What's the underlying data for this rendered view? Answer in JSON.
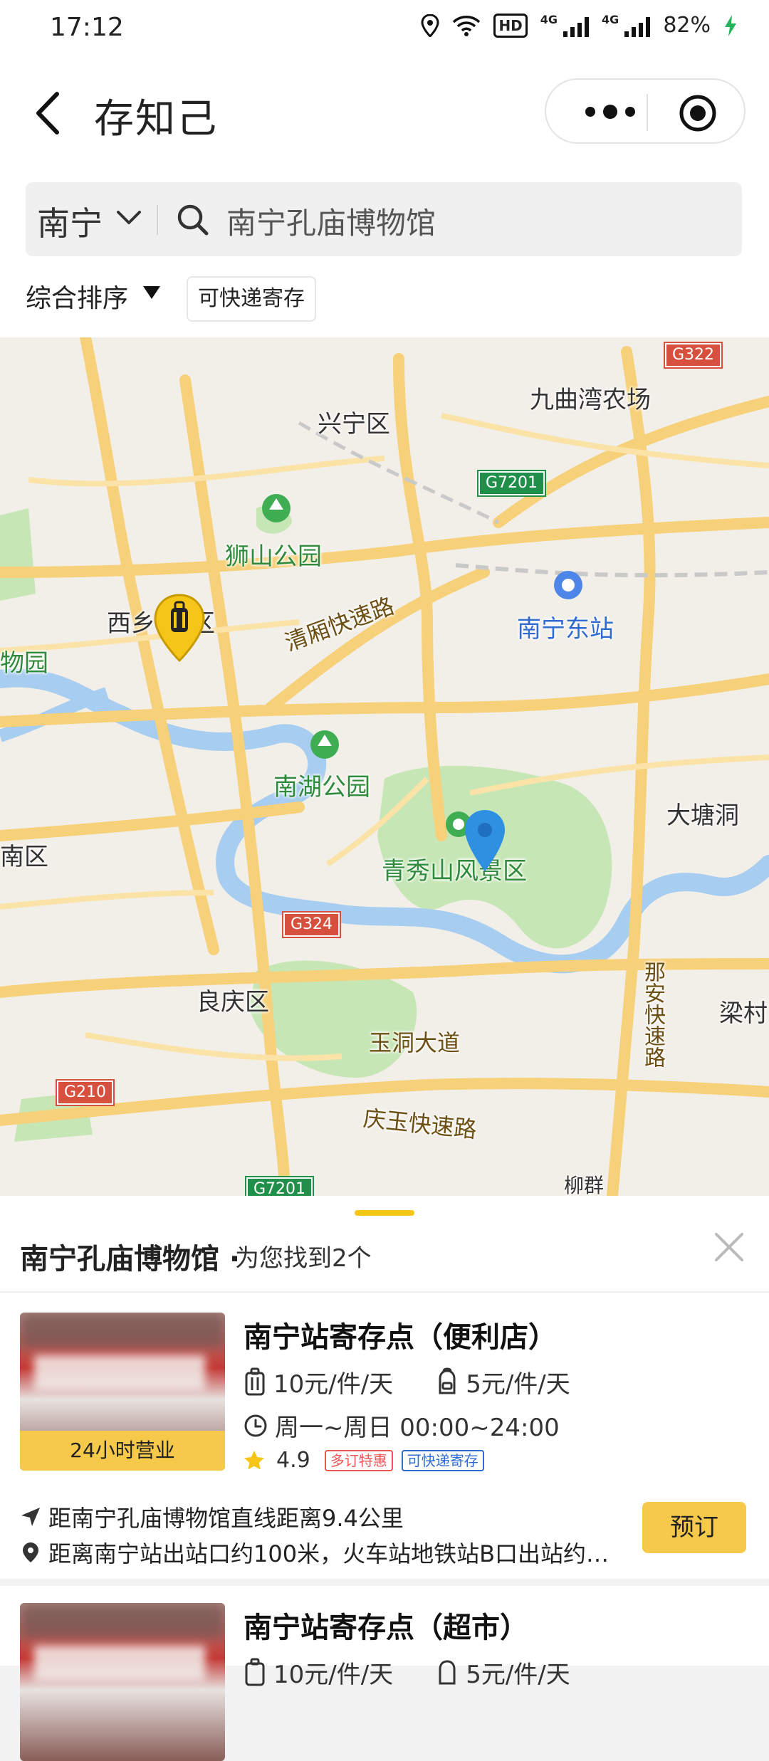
{
  "status_bar": {
    "time": "17:12",
    "hd": "HD",
    "net1": "4G",
    "net2": "4G",
    "battery": "82%"
  },
  "nav": {
    "title": "存知己"
  },
  "search": {
    "city": "南宁",
    "query": "南宁孔庙博物馆"
  },
  "filters": {
    "sort_label": "综合排序",
    "express_tag": "可快递寄存"
  },
  "map": {
    "labels": {
      "xingning": "兴宁区",
      "jiuqu": "九曲湾农场",
      "shishan": "狮山公园",
      "xixiang": "西乡",
      "xixiang_suffix": "区",
      "wuyuan": "物园",
      "qingxiang": "清厢快速路",
      "nanning_east": "南宁东站",
      "nanhu": "南湖公园",
      "qingxiu": "青秀山风景区",
      "datang": "大塘洞",
      "nanqu": "南区",
      "liangqing": "良庆区",
      "yudong": "玉洞大道",
      "naan": "那安快速路",
      "liangcun": "梁村",
      "qingyu": "庆玉快速路",
      "liuqun": "柳群"
    },
    "shields": {
      "g322": "G322",
      "g7201": "G7201",
      "g324": "G324",
      "g210": "G210",
      "g7201_bottom": "G7201"
    },
    "colors": {
      "road": "#f7d07a",
      "water": "#a7cdf0",
      "park": "#c7e6b6",
      "pin": "#2f8fe0",
      "marker": "#f5c518"
    }
  },
  "sheet": {
    "title": "南宁孔庙博物馆",
    "count_text": "为您找到2个"
  },
  "results": [
    {
      "name": "南宁站寄存点（便利店）",
      "hours_badge": "24小时营业",
      "price_large": "10元/件/天",
      "price_small": "5元/件/天",
      "open_time": "周一~周日 00:00~24:00",
      "rating": "4.9",
      "tag1": "多订特惠",
      "tag2": "可快递寄存",
      "distance": "距南宁孔庙博物馆直线距离9.4公里",
      "address": "距离南宁站出站口约100米，火车站地铁站B口出站约…",
      "book": "预订"
    },
    {
      "name": "南宁站寄存点（超市）",
      "price_large": "10元/件/天",
      "price_small": "5元/件/天"
    }
  ]
}
